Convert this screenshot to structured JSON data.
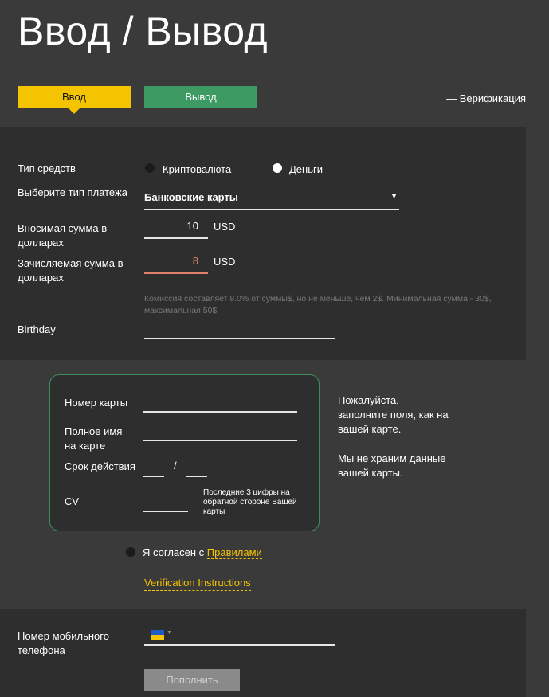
{
  "page_title": "Ввод / Вывод",
  "tabs": {
    "deposit": "Ввод",
    "withdraw": "Вывод"
  },
  "verification_link": "— Верификация",
  "form": {
    "fund_type_label": "Тип средств",
    "fund_type_options": [
      "Криптовалюта",
      "Деньги"
    ],
    "payment_type_label": "Выберите тип платежа",
    "payment_type_value": "Банковские карты",
    "deposit_amount_label": "Вносимая сумма в долларах",
    "deposit_amount_value": "10",
    "credited_amount_label": "Зачисляемая сумма в долларах",
    "credited_amount_value": "8",
    "currency": "USD",
    "commission_note": "Комиссия составляет 8.0% от суммы$, но не меньше, чем 2$. Минимальная сумма - 30$, максимальная 50$",
    "birthday_label": "Birthday"
  },
  "card": {
    "number_label": "Номер карты",
    "holder_label": "Полное имя на карте",
    "expiry_label": "Срок действия",
    "expiry_separator": "/",
    "cvv_label": "CV",
    "cvv_hint": "Последние 3 цифры на обратной стороне Вашей карты",
    "notice_1": "Пожалуйста, заполните поля, как на вашей карте.",
    "notice_2": "Мы не храним данные вашей карты."
  },
  "agree": {
    "text": "Я согласен с",
    "link": "Правилами"
  },
  "verification_instructions": "Verification Instructions",
  "phone": {
    "label": "Номер мобильного телефона",
    "flag": "ukraine-flag"
  },
  "submit_label": "Пополнить",
  "colors": {
    "accent_yellow": "#f5c400",
    "accent_green": "#3d9a63",
    "commission_red": "#e0806a"
  }
}
